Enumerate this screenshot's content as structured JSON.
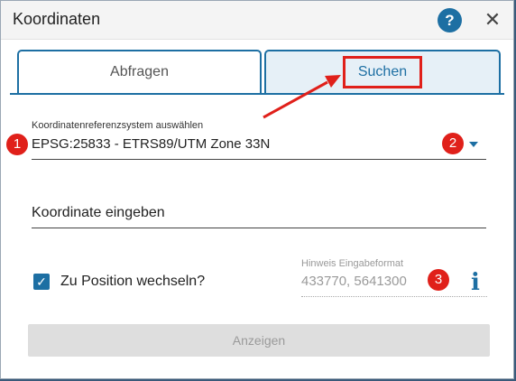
{
  "dialog": {
    "title": "Koordinaten",
    "help_glyph": "?",
    "close_glyph": "✕",
    "help_icon": "help-icon",
    "close_icon": "close-icon"
  },
  "tabs": [
    {
      "label": "Abfragen",
      "active": false
    },
    {
      "label": "Suchen",
      "active": true
    }
  ],
  "crs": {
    "label": "Koordinatenreferenzsystem auswählen",
    "value": "EPSG:25833 - ETRS89/UTM Zone 33N"
  },
  "coordinate": {
    "placeholder": "Koordinate eingeben"
  },
  "position_checkbox": {
    "label": "Zu Position wechseln?",
    "checked": true,
    "glyph": "✓"
  },
  "hint": {
    "label": "Hinweis Eingabeformat",
    "value": "433770, 5641300",
    "icon": "info-icon",
    "glyph": "i"
  },
  "submit": {
    "label": "Anzeigen",
    "disabled": true
  },
  "annotations": {
    "markers": [
      "1",
      "2",
      "3"
    ]
  },
  "colors": {
    "accent": "#1d6fa3",
    "annotation_red": "#e0201a",
    "disabled_bg": "#dedede"
  }
}
